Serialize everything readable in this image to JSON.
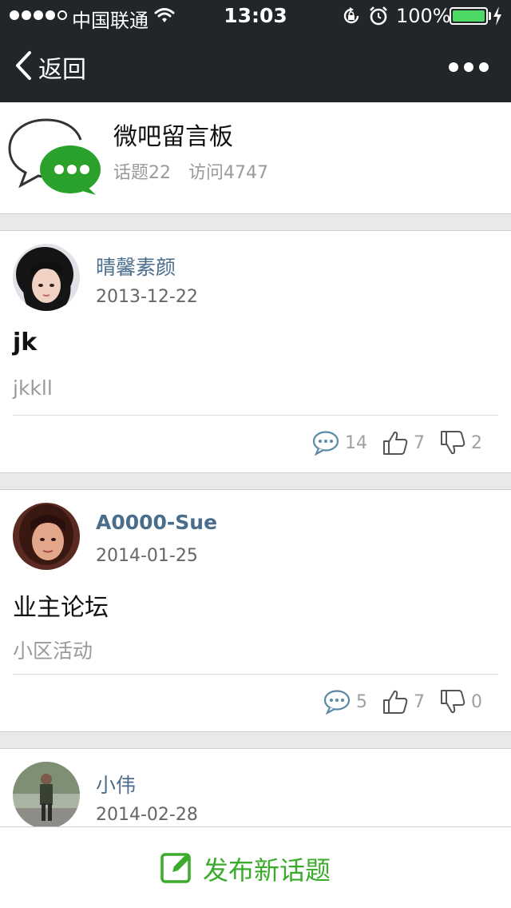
{
  "status_bar": {
    "carrier": "中国联通",
    "time": "13:03",
    "battery": "100%",
    "battery_color": "#4cd964"
  },
  "nav": {
    "back_label": "返回",
    "back_icon": "chevron-left-icon",
    "more_icon": "more-dots-icon"
  },
  "board": {
    "title": "微吧留言板",
    "topics": "话题22",
    "visits": "访问4747",
    "logo_icon": "chat-bubbles-icon",
    "brand_color": "#2aa12a"
  },
  "posts": [
    {
      "author": "晴馨素颜",
      "date": "2013-12-22",
      "title": "jk",
      "body": "jkkll",
      "comments": "14",
      "likes": "7",
      "dislikes": "2"
    },
    {
      "author": "A0000-Sue",
      "date": "2014-01-25",
      "title": "业主论坛",
      "body": "小区活动",
      "comments": "5",
      "likes": "7",
      "dislikes": "0"
    },
    {
      "author": "小伟",
      "date": "2014-02-28"
    }
  ],
  "bottom_bar": {
    "label": "发布新话题",
    "icon": "edit-icon",
    "accent": "#3bab2c"
  }
}
